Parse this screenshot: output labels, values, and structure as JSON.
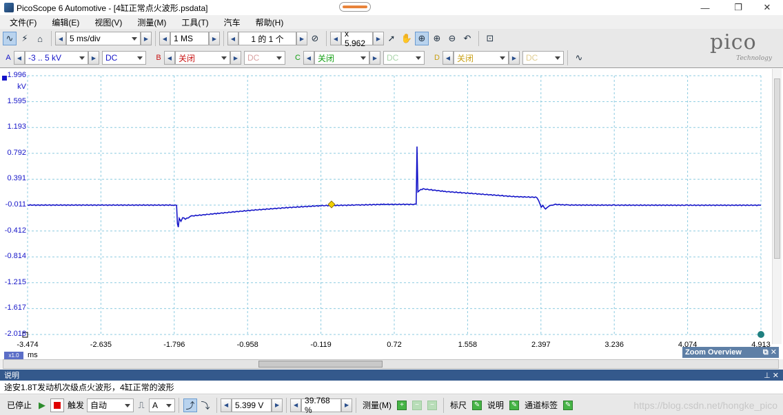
{
  "window": {
    "title": "PicoScope 6 Automotive - [4缸正常点火波形.psdata]",
    "minimize": "—",
    "restore": "❐",
    "close": "✕"
  },
  "menu": [
    "文件(F)",
    "编辑(E)",
    "视图(V)",
    "测量(M)",
    "工具(T)",
    "汽车",
    "帮助(H)"
  ],
  "toolbar": {
    "timebase": "5 ms/div",
    "samples": "1 MS",
    "buffer": "1 的 1 个",
    "zoom": "x 5.962"
  },
  "channels": [
    {
      "letter": "A",
      "range": "-3 .. 5 kV",
      "coupling": "DC",
      "color": "#1414c8"
    },
    {
      "letter": "B",
      "range": "关闭",
      "coupling": "DC",
      "color": "#c81414"
    },
    {
      "letter": "C",
      "range": "关闭",
      "coupling": "DC",
      "color": "#14a014"
    },
    {
      "letter": "D",
      "range": "关闭",
      "coupling": "DC",
      "color": "#c8a014"
    }
  ],
  "logo": {
    "word": "pico",
    "sub": "Technology"
  },
  "plot": {
    "y_unit": "kV",
    "y_ticks": [
      "1.996",
      "1.595",
      "1.193",
      "0.792",
      "0.391",
      "-0.011",
      "-0.412",
      "-0.814",
      "-1.215",
      "-1.617",
      "-2.018"
    ],
    "x_ticks": [
      "-3.474",
      "-2.635",
      "-1.796",
      "-0.958",
      "-0.119",
      "0.72",
      "1.558",
      "2.397",
      "3.236",
      "4.074",
      "4.913"
    ],
    "x_unit": "ms",
    "x_zoom": "x1.0",
    "zoom_overview": "Zoom Overview",
    "zoom_ctl": "⧉ ✕"
  },
  "chart_data": {
    "type": "line",
    "title": "",
    "xlabel": "ms",
    "ylabel": "kV",
    "xlim": [
      -3.474,
      4.913
    ],
    "ylim": [
      -2.018,
      1.996
    ],
    "grid": true,
    "series": [
      {
        "color": "#1414c8",
        "points": [
          [
            -3.474,
            -0.011
          ],
          [
            -1.8,
            -0.011
          ],
          [
            -1.77,
            -0.011
          ],
          [
            -1.76,
            -0.3
          ],
          [
            -1.75,
            -0.36
          ],
          [
            -1.74,
            -0.22
          ],
          [
            -1.72,
            -0.26
          ],
          [
            -1.7,
            -0.2
          ],
          [
            -1.67,
            -0.23
          ],
          [
            -1.6,
            -0.18
          ],
          [
            -1.3,
            -0.14
          ],
          [
            -0.9,
            -0.09
          ],
          [
            -0.5,
            -0.05
          ],
          [
            -0.119,
            -0.02
          ],
          [
            0.3,
            -0.01
          ],
          [
            0.6,
            0.0
          ],
          [
            0.97,
            0.0
          ],
          [
            0.98,
            0.9
          ],
          [
            0.99,
            0.2
          ],
          [
            1.01,
            0.22
          ],
          [
            1.05,
            0.24
          ],
          [
            1.3,
            0.2
          ],
          [
            1.7,
            0.16
          ],
          [
            2.1,
            0.12
          ],
          [
            2.35,
            0.11
          ],
          [
            2.37,
            0.06
          ],
          [
            2.4,
            -0.05
          ],
          [
            2.42,
            -0.02
          ],
          [
            2.45,
            -0.07
          ],
          [
            2.48,
            -0.03
          ],
          [
            2.55,
            0.0
          ],
          [
            2.7,
            -0.01
          ],
          [
            3.236,
            -0.012
          ],
          [
            4.074,
            -0.013
          ],
          [
            4.913,
            -0.013
          ]
        ]
      }
    ]
  },
  "description": {
    "header": "说明",
    "ctl": "⊥ ✕",
    "text": "途安1.8T发动机次级点火波形，4缸正常的波形"
  },
  "bottom": {
    "stop": "已停止",
    "trigger": "触发",
    "mode": "自动",
    "source": "A",
    "level": "5.399 V",
    "pretrigger": "39.768 %",
    "measure": "测量(M)",
    "ruler": "标尺",
    "notes": "说明",
    "channel_labels": "通道标签"
  },
  "watermark": "https://blog.csdn.net/hongke_pico"
}
